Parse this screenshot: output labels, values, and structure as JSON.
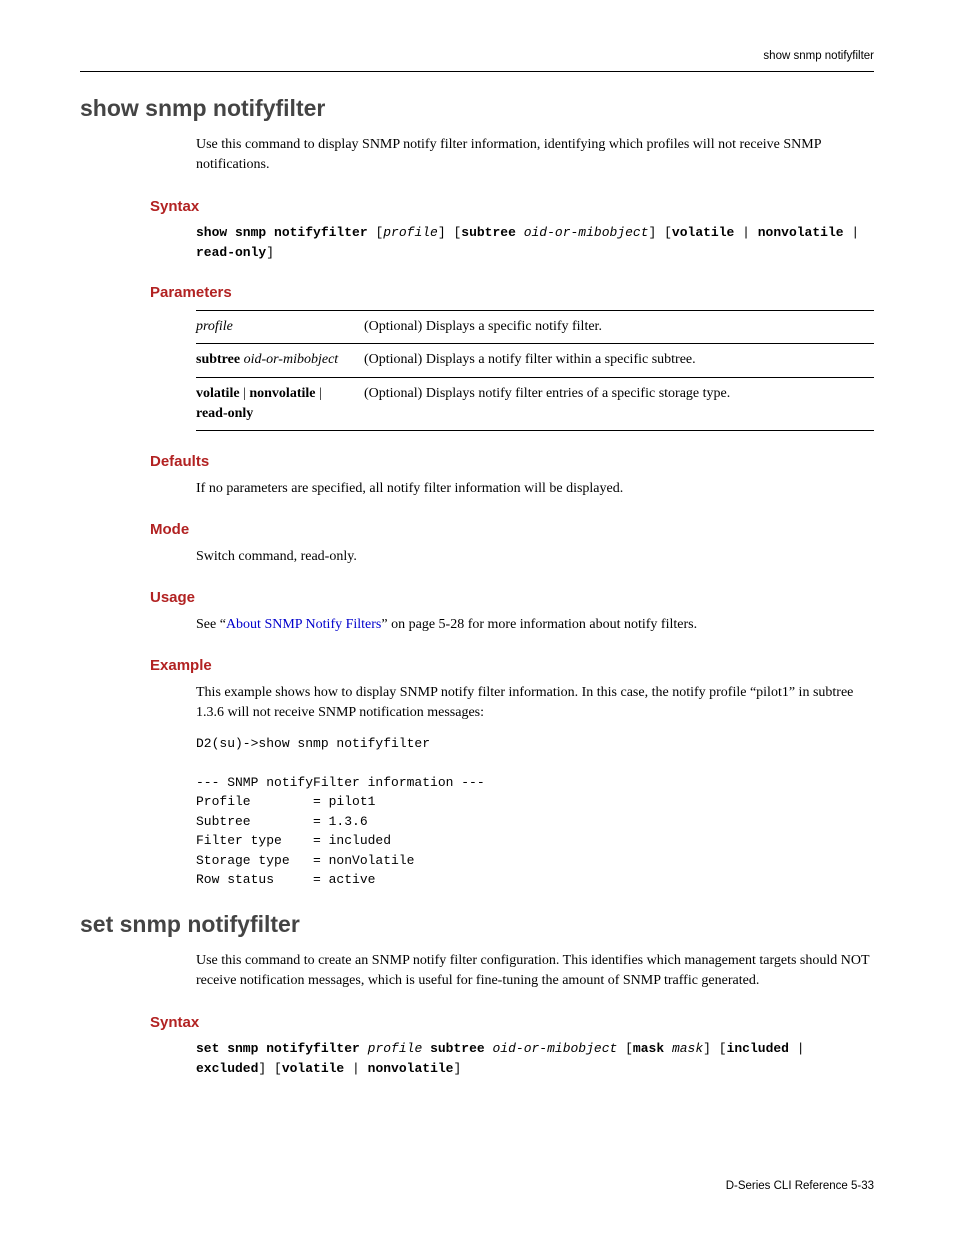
{
  "header": {
    "right": "show snmp notifyfilter"
  },
  "footer": {
    "text": "D-Series CLI Reference    5-33"
  },
  "sections": [
    {
      "title": "show snmp notifyfilter",
      "intro": "Use this command to display SNMP notify filter information, identifying which profiles will not receive SNMP notifications.",
      "blocks": [
        {
          "heading": "Syntax",
          "syntax_html": "<b>show snmp notifyfilter</b> [<i>profile</i>] [<b>subtree</b> <i>oid-or-mibobject</i>] [<b>volatile</b> | <b>nonvolatile</b> | <b>read-only</b>]"
        },
        {
          "heading": "Parameters",
          "params": [
            {
              "name_html": "<i>profile</i>",
              "desc": "(Optional) Displays a specific notify filter."
            },
            {
              "name_html": "<b>subtree</b> <i>oid-or-mibobject</i>",
              "desc": "(Optional) Displays a notify filter within a specific subtree."
            },
            {
              "name_html": "<b>volatile</b> | <b>nonvolatile</b> | <b>read-only</b>",
              "desc": "(Optional) Displays notify filter entries of a specific storage type."
            }
          ]
        },
        {
          "heading": "Defaults",
          "text": "If no parameters are specified, all notify filter information will be displayed."
        },
        {
          "heading": "Mode",
          "text": "Switch command, read-only."
        },
        {
          "heading": "Usage",
          "usage_prefix": "See “",
          "usage_link": "About SNMP Notify Filters",
          "usage_suffix": "” on page 5-28 for more information about notify filters."
        },
        {
          "heading": "Example",
          "text": "This example shows how to display SNMP notify filter information. In this case, the notify profile “pilot1” in subtree 1.3.6 will not receive SNMP notification messages:",
          "output": "D2(su)->show snmp notifyfilter\n\n--- SNMP notifyFilter information ---\nProfile        = pilot1\nSubtree        = 1.3.6\nFilter type    = included\nStorage type   = nonVolatile\nRow status     = active"
        }
      ]
    },
    {
      "title": "set snmp notifyfilter",
      "intro": "Use this command to create an SNMP notify filter configuration. This identifies which management targets should NOT receive notification messages, which is useful for fine-tuning the amount of SNMP traffic generated.",
      "blocks": [
        {
          "heading": "Syntax",
          "syntax_html": "<b>set snmp notifyfilter</b> <i>profile</i> <b>subtree</b> <i>oid-or-mibobject</i> [<b>mask</b> <i>mask</i>] [<b>included</b> | <b>excluded</b>] [<b>volatile</b> | <b>nonvolatile</b>]"
        }
      ]
    }
  ]
}
